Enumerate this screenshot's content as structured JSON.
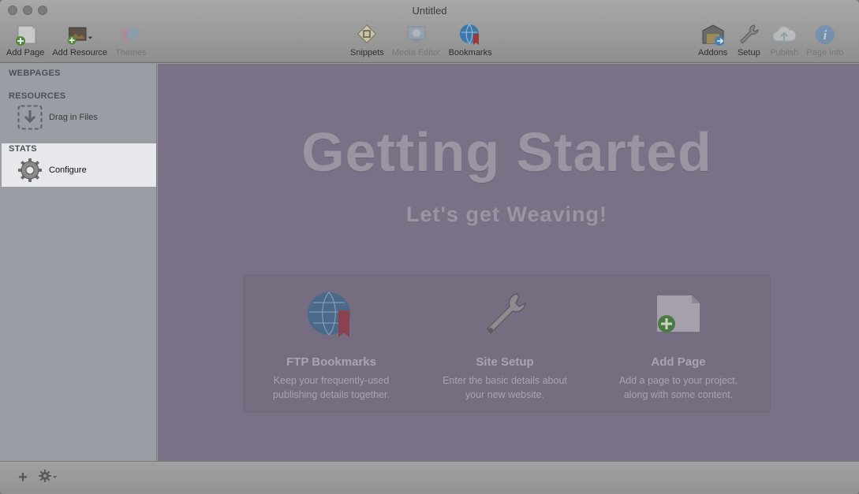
{
  "window": {
    "title": "Untitled"
  },
  "toolbar": {
    "left": [
      {
        "label": "Add Page",
        "icon": "add-page-icon",
        "enabled": true
      },
      {
        "label": "Add Resource",
        "icon": "add-resource-icon",
        "enabled": true
      },
      {
        "label": "Themes",
        "icon": "themes-icon",
        "enabled": false
      }
    ],
    "center": [
      {
        "label": "Snippets",
        "icon": "snippets-icon",
        "enabled": true
      },
      {
        "label": "Media Editor",
        "icon": "media-editor-icon",
        "enabled": false
      },
      {
        "label": "Bookmarks",
        "icon": "bookmarks-icon",
        "enabled": true
      }
    ],
    "right": [
      {
        "label": "Addons",
        "icon": "addons-icon",
        "enabled": true
      },
      {
        "label": "Setup",
        "icon": "setup-icon",
        "enabled": true
      },
      {
        "label": "Publish",
        "icon": "publish-icon",
        "enabled": false
      },
      {
        "label": "Page Info",
        "icon": "page-info-icon",
        "enabled": false
      }
    ]
  },
  "sidebar": {
    "webpages_heading": "WEBPAGES",
    "resources_heading": "RESOURCES",
    "drag_in_files": "Drag in Files",
    "stats_heading": "STATS",
    "configure": "Configure"
  },
  "main": {
    "headline": "Getting Started",
    "subheadline": "Let's get Weaving!",
    "features": [
      {
        "title": "FTP Bookmarks",
        "line1": "Keep your frequently-used",
        "line2": "publishing details together.",
        "icon": "globe-bookmark-icon"
      },
      {
        "title": "Site Setup",
        "line1": "Enter the basic details about",
        "line2": "your new website.",
        "icon": "wrench-icon"
      },
      {
        "title": "Add Page",
        "line1": "Add a page to your project,",
        "line2": "along with some content.",
        "icon": "add-page-icon"
      }
    ]
  },
  "bottombar": {
    "add_symbol": "+"
  },
  "colors": {
    "overlay": "#7b7186",
    "sidebar": "#9a9ea4",
    "highlight": "#e6e8ec"
  }
}
